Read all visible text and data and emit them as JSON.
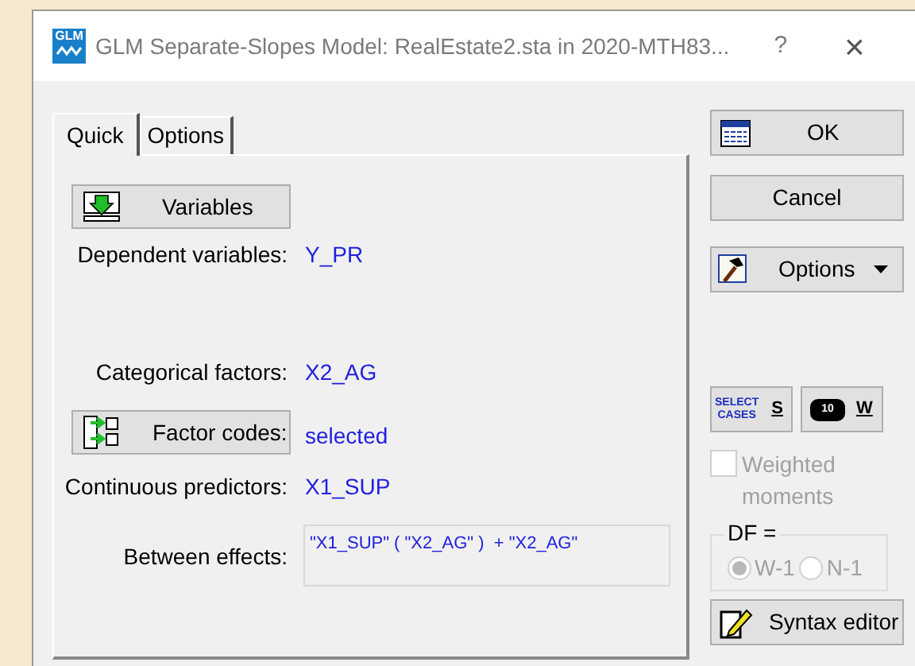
{
  "window": {
    "logo_text": "GLM",
    "title": "GLM Separate-Slopes Model: RealEstate2.sta in 2020-MTH83...",
    "help": "?",
    "close": "×"
  },
  "tabs": [
    {
      "label": "Quick",
      "selected": true
    },
    {
      "label": "Options",
      "selected": false
    }
  ],
  "quick": {
    "variables_button": "Variables",
    "fields": [
      {
        "kind": "value",
        "label": "Dependent variables:",
        "value": "Y_PR"
      },
      {
        "kind": "value",
        "label": "Categorical factors:",
        "value": "X2_AG"
      },
      {
        "kind": "button",
        "label": "Factor codes:",
        "value": "selected"
      },
      {
        "kind": "value",
        "label": "Continuous predictors:",
        "value": "X1_SUP"
      },
      {
        "kind": "box",
        "label": "Between effects:",
        "value": "\"X1_SUP\" ( \"X2_AG\" )  + \"X2_AG\""
      }
    ]
  },
  "side": {
    "ok": "OK",
    "cancel": "Cancel",
    "options": "Options",
    "select_cases": {
      "icon_text": [
        "SELECT",
        "CASES"
      ],
      "label": "S"
    },
    "weight": {
      "icon_text": "10",
      "label": "W"
    },
    "weighted": {
      "label": "Weighted moments",
      "checked": false,
      "disabled": true
    },
    "df": {
      "legend": "DF =",
      "disabled": true,
      "options": [
        {
          "label": "W-1",
          "selected": true
        },
        {
          "label": "N-1",
          "selected": false
        }
      ]
    },
    "syntax_editor": "Syntax editor"
  }
}
